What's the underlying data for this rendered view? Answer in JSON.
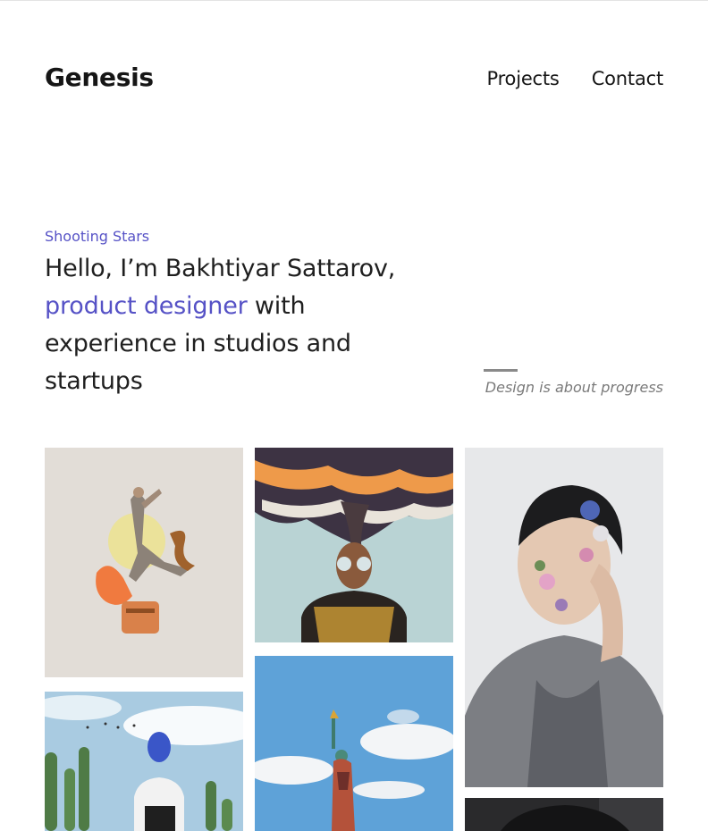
{
  "header": {
    "brand": "Genesis",
    "nav": [
      "Projects",
      "Contact"
    ]
  },
  "hero": {
    "eyebrow": "Shooting Stars",
    "headline_part1": "Hello, I’m Bakhtiyar Sattarov, ",
    "headline_accent": "product designer",
    "headline_part2": " with experience in studios and startups",
    "tagline": "Design is about progress"
  },
  "colors": {
    "accent": "#5652c6",
    "text": "#1f1f1f",
    "muted": "#7a7a7a"
  },
  "gallery": [
    {
      "name": "dancer-collage-image"
    },
    {
      "name": "smoke-portrait-image"
    },
    {
      "name": "flower-face-portrait-image"
    },
    {
      "name": "cactus-balloon-image"
    },
    {
      "name": "statue-of-liberty-image"
    },
    {
      "name": "dark-portrait-image"
    }
  ]
}
